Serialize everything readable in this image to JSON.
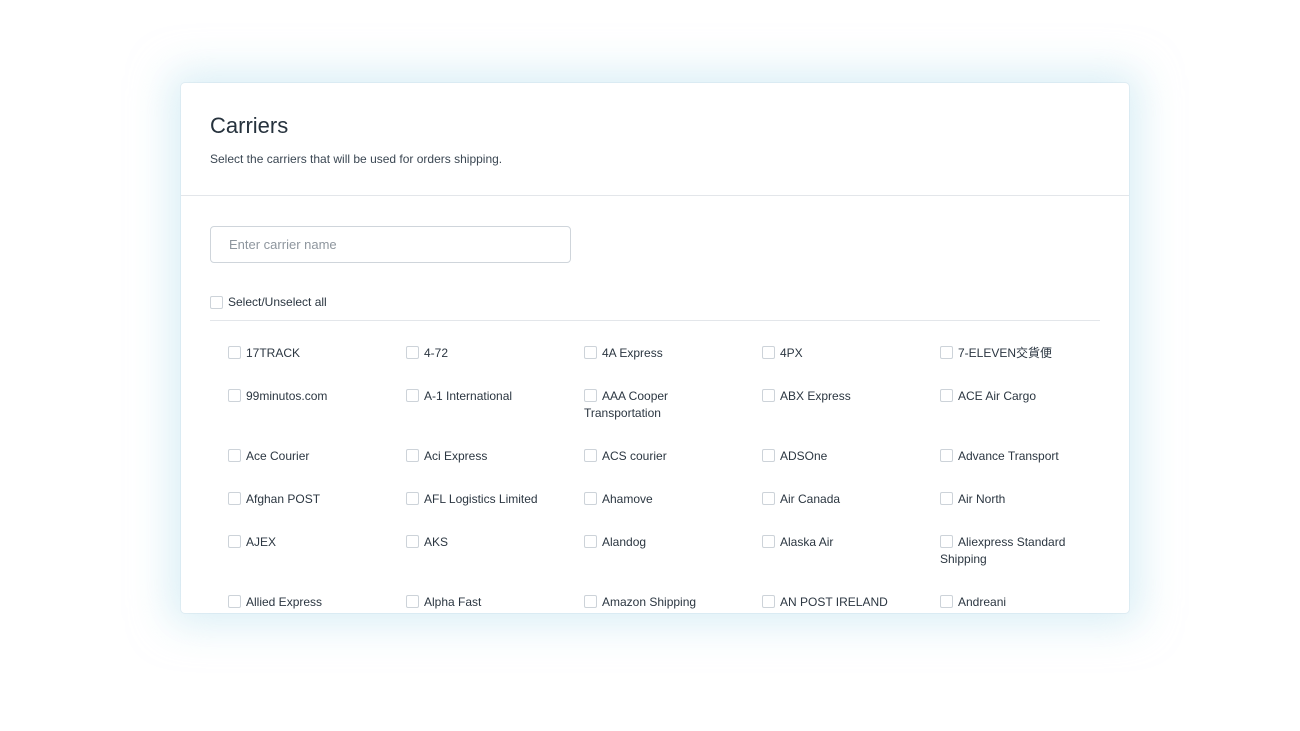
{
  "header": {
    "title": "Carriers",
    "subtitle": "Select the carriers that will be used for orders shipping."
  },
  "search": {
    "placeholder": "Enter carrier name",
    "value": ""
  },
  "select_all": {
    "label": "Select/Unselect all",
    "checked": false
  },
  "carriers": [
    {
      "label": "17TRACK",
      "checked": false
    },
    {
      "label": "4-72",
      "checked": false
    },
    {
      "label": "4A Express",
      "checked": false
    },
    {
      "label": "4PX",
      "checked": false
    },
    {
      "label": "7-ELEVEN交貨便",
      "checked": false
    },
    {
      "label": "99minutos.com",
      "checked": false
    },
    {
      "label": "A-1 International",
      "checked": false
    },
    {
      "label": "AAA Cooper Transportation",
      "checked": false
    },
    {
      "label": "ABX Express",
      "checked": false
    },
    {
      "label": "ACE Air Cargo",
      "checked": false
    },
    {
      "label": "Ace Courier",
      "checked": false
    },
    {
      "label": "Aci Express",
      "checked": false
    },
    {
      "label": "ACS courier",
      "checked": false
    },
    {
      "label": "ADSOne",
      "checked": false
    },
    {
      "label": "Advance Transport",
      "checked": false
    },
    {
      "label": "Afghan POST",
      "checked": false
    },
    {
      "label": "AFL Logistics Limited",
      "checked": false
    },
    {
      "label": "Ahamove",
      "checked": false
    },
    {
      "label": "Air Canada",
      "checked": false
    },
    {
      "label": "Air North",
      "checked": false
    },
    {
      "label": "AJEX",
      "checked": false
    },
    {
      "label": "AKS",
      "checked": false
    },
    {
      "label": "Alandog",
      "checked": false
    },
    {
      "label": "Alaska Air",
      "checked": false
    },
    {
      "label": "Aliexpress Standard Shipping",
      "checked": false
    },
    {
      "label": "Allied Express",
      "checked": false
    },
    {
      "label": "Alpha Fast",
      "checked": false
    },
    {
      "label": "Amazon Shipping",
      "checked": false
    },
    {
      "label": "AN POST IRELAND",
      "checked": false
    },
    {
      "label": "Andreani",
      "checked": false
    }
  ]
}
